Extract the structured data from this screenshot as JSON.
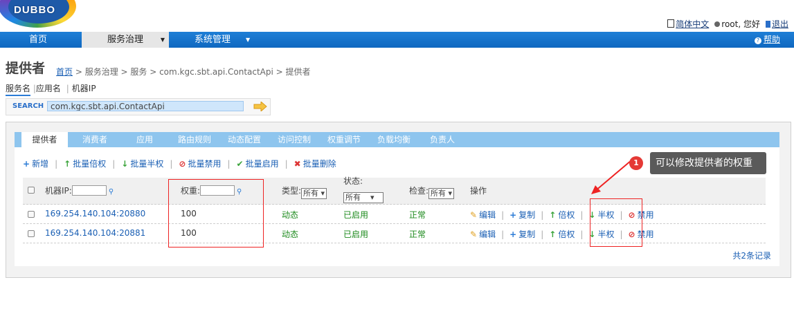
{
  "header": {
    "logo_text": "DUBBO",
    "lang_link": "简体中文",
    "user_text": "root, 您好",
    "logout": "退出"
  },
  "nav": {
    "items": [
      "首页",
      "服务治理",
      "系统管理"
    ],
    "help": "帮助"
  },
  "page": {
    "title": "提供者",
    "breadcrumb": {
      "home": "首页",
      "rest": " > 服务治理 > 服务 > com.kgc.sbt.api.ContactApi > 提供者"
    },
    "search_tabs": [
      "服务名",
      "应用名",
      "机器IP"
    ],
    "search_label": "SEARCH",
    "search_value": "com.kgc.sbt.api.ContactApi"
  },
  "tabs": [
    "提供者",
    "消费者",
    "应用",
    "路由规则",
    "动态配置",
    "访问控制",
    "权重调节",
    "负载均衡",
    "负责人"
  ],
  "toolbar": [
    "新增",
    "批量倍权",
    "批量半权",
    "批量禁用",
    "批量启用",
    "批量删除"
  ],
  "table": {
    "headers": {
      "ip": "机器IP:",
      "weight": "权重:",
      "type": "类型:",
      "type_select": "所有",
      "status": "状态:",
      "status_select": "所有",
      "check": "检查:",
      "check_select": "所有",
      "ops": "操作"
    },
    "rows": [
      {
        "ip": "169.254.140.104:20880",
        "weight": "100",
        "type": "动态",
        "status": "已启用",
        "check": "正常"
      },
      {
        "ip": "169.254.140.104:20881",
        "weight": "100",
        "type": "动态",
        "status": "已启用",
        "check": "正常"
      }
    ],
    "row_ops": [
      "编辑",
      "复制",
      "倍权",
      "半权",
      "禁用"
    ],
    "count_text": "共2条记录"
  },
  "annotation": {
    "badge": "1",
    "text": "可以修改提供者的权重"
  }
}
